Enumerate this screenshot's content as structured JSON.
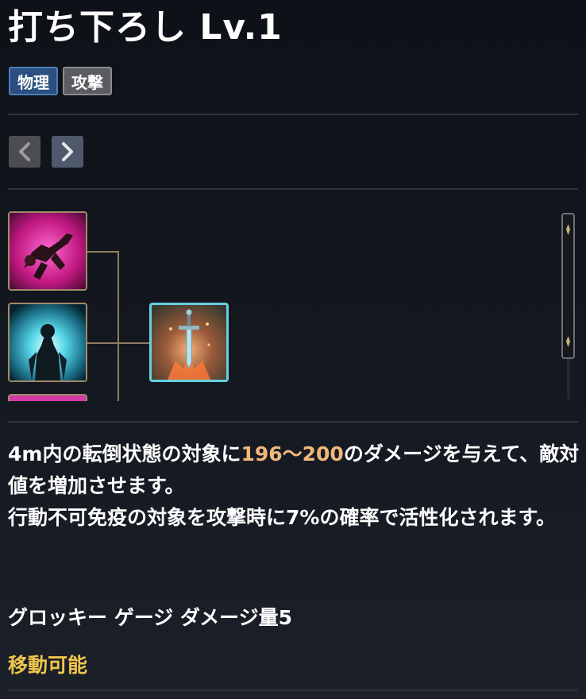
{
  "header": {
    "title": "打ち下ろし Lv.1"
  },
  "tags": [
    {
      "label": "物理",
      "color": "#2a4f80"
    },
    {
      "label": "攻撃",
      "color": "#5a5c62"
    }
  ],
  "navigation": {
    "prev_icon": "chevron-left-icon",
    "next_icon": "chevron-right-icon"
  },
  "skill_tree": {
    "skills": [
      {
        "name": "knockdown-skill-icon"
      },
      {
        "name": "aura-skill-icon"
      },
      {
        "name": "partial-skill-icon"
      },
      {
        "name": "sword-skill-icon",
        "selected": true
      }
    ]
  },
  "description": {
    "line1_pre": "4m内の転倒状態の対象に",
    "damage_range": "196〜200",
    "line1_post": "のダメージを与えて、敵対値を増加させます。",
    "line2": "行動不可免疫の対象を攻撃時に7%の確率で活性化されます。"
  },
  "groggy": "グロッキー ゲージ ダメージ量5",
  "movable": "移動可能",
  "colors": {
    "highlight": "#f0b87a",
    "movable": "#f0c64a",
    "selected_border": "#67d0e0"
  }
}
